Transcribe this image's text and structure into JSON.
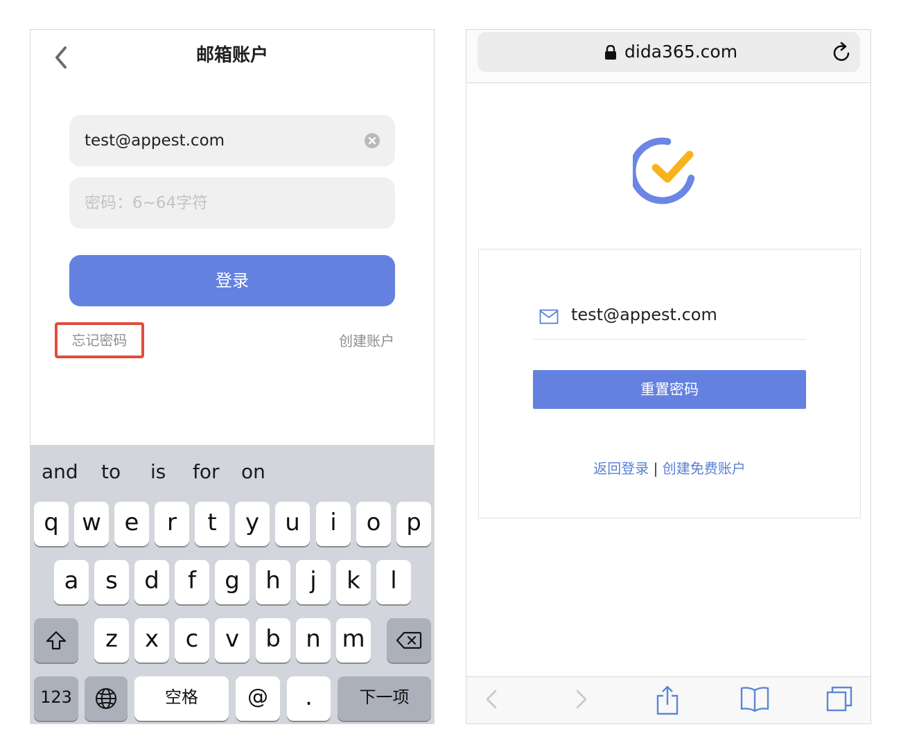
{
  "left_screen": {
    "nav": {
      "title": "邮箱账户",
      "back_icon": "chevron-left-icon"
    },
    "email_field": {
      "value": "test@appest.com",
      "clear_icon": "clear-circle-icon"
    },
    "password_field": {
      "placeholder": "密码：6~64字符"
    },
    "login_button": "登录",
    "forgot_password": "忘记密码",
    "create_account": "创建账户",
    "highlight_color": "#e04d3a",
    "accent_color": "#6481e0",
    "keyboard": {
      "suggestions": [
        "and",
        "to",
        "is",
        "for",
        "on"
      ],
      "row1": [
        "q",
        "w",
        "e",
        "r",
        "t",
        "y",
        "u",
        "i",
        "o",
        "p"
      ],
      "row2": [
        "a",
        "s",
        "d",
        "f",
        "g",
        "h",
        "j",
        "k",
        "l"
      ],
      "row3": [
        "z",
        "x",
        "c",
        "v",
        "b",
        "n",
        "m"
      ],
      "shift_icon": "shift-icon",
      "backspace_icon": "backspace-icon",
      "numbers": "123",
      "globe_icon": "globe-icon",
      "space": "空格",
      "at": "@",
      "dot": ".",
      "next": "下一项"
    }
  },
  "right_screen": {
    "browser": {
      "url": "dida365.com",
      "lock_icon": "lock-icon",
      "reload_icon": "reload-icon"
    },
    "logo_icon": "dida-check-logo-icon",
    "email": "test@appest.com",
    "mail_icon": "mail-icon",
    "reset_button": "重置密码",
    "back_to_login": "返回登录",
    "separator": "|",
    "create_free_account": "创建免费账户",
    "toolbar_icons": [
      "back-icon",
      "forward-icon",
      "share-icon",
      "bookmarks-icon",
      "tabs-icon"
    ]
  }
}
